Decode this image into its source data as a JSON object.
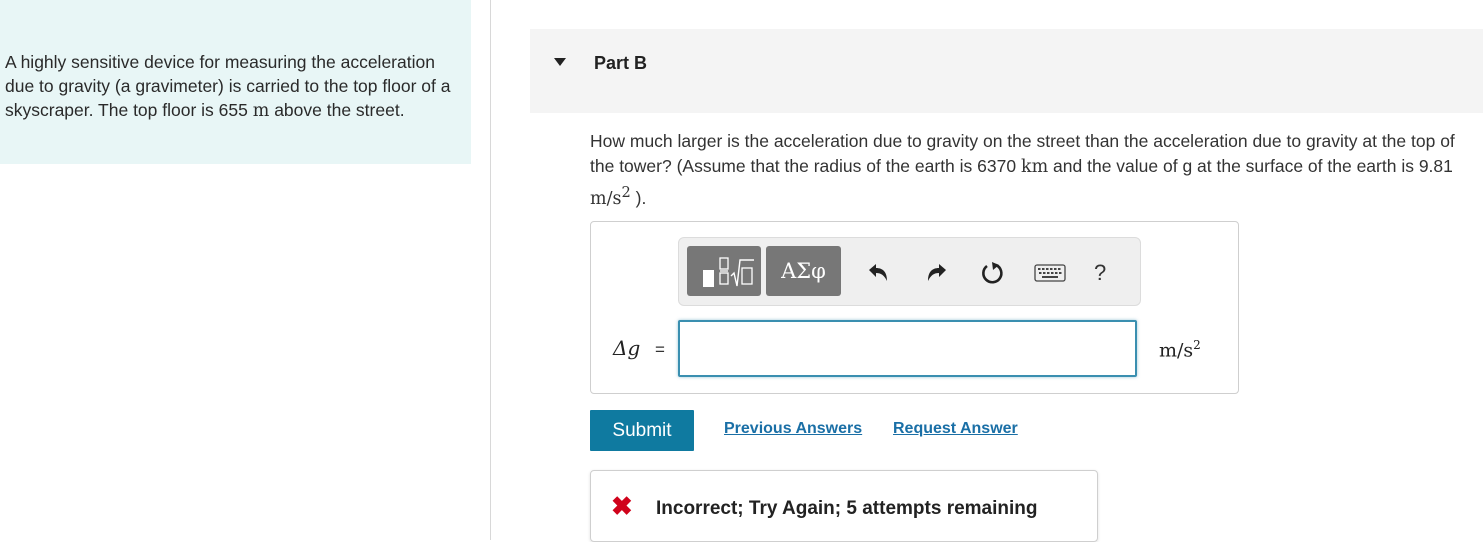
{
  "intro": {
    "text_before_unit": "A highly sensitive device for measuring the acceleration due to gravity (a gravimeter) is carried to the top floor of a skyscraper. The top floor is 655 ",
    "unit": "m",
    "text_after_unit": " above the street."
  },
  "part": {
    "title": "Part B"
  },
  "question": {
    "text_1": "How much larger is the acceleration due to gravity on the street than the acceleration due to gravity at the top of the tower? (Assume that the radius of the earth is ",
    "radius_value": "6370",
    "radius_unit": "km",
    "text_2": " and the value of g at the surface of the earth is 9.81 ",
    "g_unit": "m/s",
    "g_unit_exp": "2",
    "text_3": " )."
  },
  "toolbar": {
    "greek_label": "ΑΣφ",
    "help_label": "?",
    "icons": [
      "templates-icon",
      "undo-icon",
      "redo-icon",
      "reset-icon",
      "keyboard-icon",
      "help-icon"
    ]
  },
  "answer": {
    "variable": "Δg",
    "equals": "=",
    "value": "",
    "units": "m/s",
    "units_exp": "2"
  },
  "actions": {
    "submit_label": "Submit",
    "previous_answers_label": "Previous Answers",
    "request_answer_label": "Request Answer"
  },
  "feedback": {
    "icon": "✖",
    "message": "Incorrect; Try Again; 5 attempts remaining",
    "color": "#d0021b"
  },
  "colors": {
    "intro_bg": "#e8f6f6",
    "accent": "#0f7aa0",
    "link": "#1a6fa6"
  }
}
